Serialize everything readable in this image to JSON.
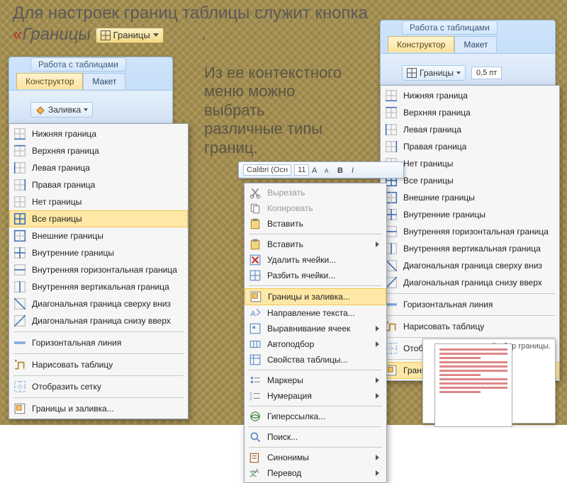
{
  "headline_pre": "Для настроек границ таблицы служит кнопка ",
  "headline_quote_open": "«",
  "headline_keyword": "Границы",
  "border_button_label": "Границы",
  "headline_period": ".",
  "bodytext": "Из ее контекстного меню можно выбрать различные типы границ.",
  "ribbon": {
    "title": "Работа с таблицами",
    "tab_design": "Конструктор",
    "tab_layout": "Макет",
    "fill_label": "Заливка",
    "borders_label": "Границы",
    "pt_label": "0,5 пт"
  },
  "border_menu": [
    "Нижняя граница",
    "Верхняя граница",
    "Левая граница",
    "Правая граница",
    "Нет границы",
    "Все границы",
    "Внешние границы",
    "Внутренние границы",
    "Внутренняя горизонтальная граница",
    "Внутренняя вертикальная граница",
    "Диагональная граница сверху вниз",
    "Диагональная граница снизу вверх",
    "---",
    "Горизонтальная линия",
    "---",
    "Нарисовать таблицу",
    "---",
    "Отобразить сетку",
    "---",
    "Границы и заливка..."
  ],
  "mini_toolbar": {
    "font": "Calibri (Осн",
    "size": "11"
  },
  "context_menu": [
    {
      "label": "Вырезать",
      "dim": true
    },
    {
      "label": "Копировать",
      "dim": true
    },
    {
      "label": "Вставить"
    },
    {
      "label": "---"
    },
    {
      "label": "Вставить",
      "sub": true
    },
    {
      "label": "Удалить ячейки..."
    },
    {
      "label": "Разбить ячейки..."
    },
    {
      "label": "---"
    },
    {
      "label": "Границы и заливка...",
      "hl": true
    },
    {
      "label": "Направление текста..."
    },
    {
      "label": "Выравнивание ячеек",
      "sub": true
    },
    {
      "label": "Автоподбор",
      "sub": true
    },
    {
      "label": "Свойства таблицы..."
    },
    {
      "label": "---"
    },
    {
      "label": "Маркеры",
      "sub": true
    },
    {
      "label": "Нумерация",
      "sub": true
    },
    {
      "label": "---"
    },
    {
      "label": "Гиперссылка..."
    },
    {
      "label": "---"
    },
    {
      "label": "Поиск..."
    },
    {
      "label": "---"
    },
    {
      "label": "Синонимы",
      "sub": true
    },
    {
      "label": "Перевод",
      "sub": true
    }
  ],
  "left_highlight_index": 5,
  "right_highlight_index": 19,
  "thumb_caption": "Выбор границы."
}
